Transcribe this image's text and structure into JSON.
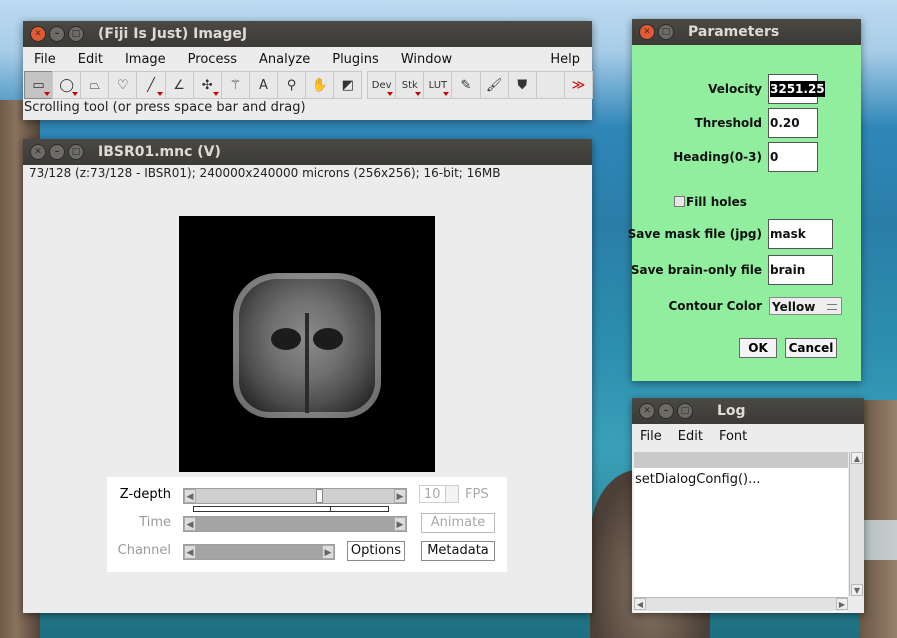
{
  "imagej": {
    "title": "(Fiji Is Just) ImageJ",
    "menu": [
      "File",
      "Edit",
      "Image",
      "Process",
      "Analyze",
      "Plugins",
      "Window",
      "Help"
    ],
    "tools": [
      {
        "name": "rectangle-tool",
        "glyph": "▭"
      },
      {
        "name": "oval-tool",
        "glyph": "◯"
      },
      {
        "name": "polygon-tool",
        "glyph": "⏢"
      },
      {
        "name": "freehand-tool",
        "glyph": "♡"
      },
      {
        "name": "line-tool",
        "glyph": "╱"
      },
      {
        "name": "angle-tool",
        "glyph": "∠"
      },
      {
        "name": "point-tool",
        "glyph": "✣"
      },
      {
        "name": "wand-tool",
        "glyph": "⚚"
      },
      {
        "name": "text-tool",
        "glyph": "A"
      },
      {
        "name": "magnifier-tool",
        "glyph": "⚲"
      },
      {
        "name": "hand-tool",
        "glyph": "✋"
      },
      {
        "name": "color-picker-tool",
        "glyph": "◩"
      }
    ],
    "tools2": [
      {
        "name": "dev-menu-tool",
        "glyph": "Dev"
      },
      {
        "name": "stk-menu-tool",
        "glyph": "Stk"
      },
      {
        "name": "lut-menu-tool",
        "glyph": "LUT"
      },
      {
        "name": "pencil-tool",
        "glyph": "✎"
      },
      {
        "name": "brush-tool",
        "glyph": "🖌"
      },
      {
        "name": "flood-fill-tool",
        "glyph": "⛊"
      },
      {
        "name": "blank-tool",
        "glyph": ""
      },
      {
        "name": "more-tools",
        "glyph": "≫"
      }
    ],
    "status": "Scrolling tool (or press space bar and drag)"
  },
  "image_window": {
    "title": "IBSR01.mnc (V)",
    "info": "73/128 (z:73/128 - IBSR01); 240000x240000 microns (256x256); 16-bit; 16MB",
    "zdepth_label": "Z-depth",
    "zdepth_position": 0.62,
    "time_label": "Time",
    "channel_label": "Channel",
    "fps_value": "10",
    "fps_label": "FPS",
    "animate_label": "Animate",
    "options_label": "Options",
    "metadata_label": "Metadata"
  },
  "parameters": {
    "title": "Parameters",
    "velocity_label": "Velocity",
    "velocity_value": "3251.25",
    "threshold_label": "Threshold",
    "threshold_value": "0.20",
    "heading_label": "Heading(0-3)",
    "heading_value": "0",
    "fill_holes_label": "Fill holes",
    "save_mask_label": "Save mask file (jpg)",
    "save_mask_value": "mask",
    "save_brain_label": "Save brain-only file",
    "save_brain_value": "brain",
    "contour_label": "Contour Color",
    "contour_value": "Yellow",
    "ok_label": "OK",
    "cancel_label": "Cancel",
    "background": "#90ee9e"
  },
  "log": {
    "title": "Log",
    "menu": [
      "File",
      "Edit",
      "Font"
    ],
    "text": "setDialogConfig()..."
  }
}
